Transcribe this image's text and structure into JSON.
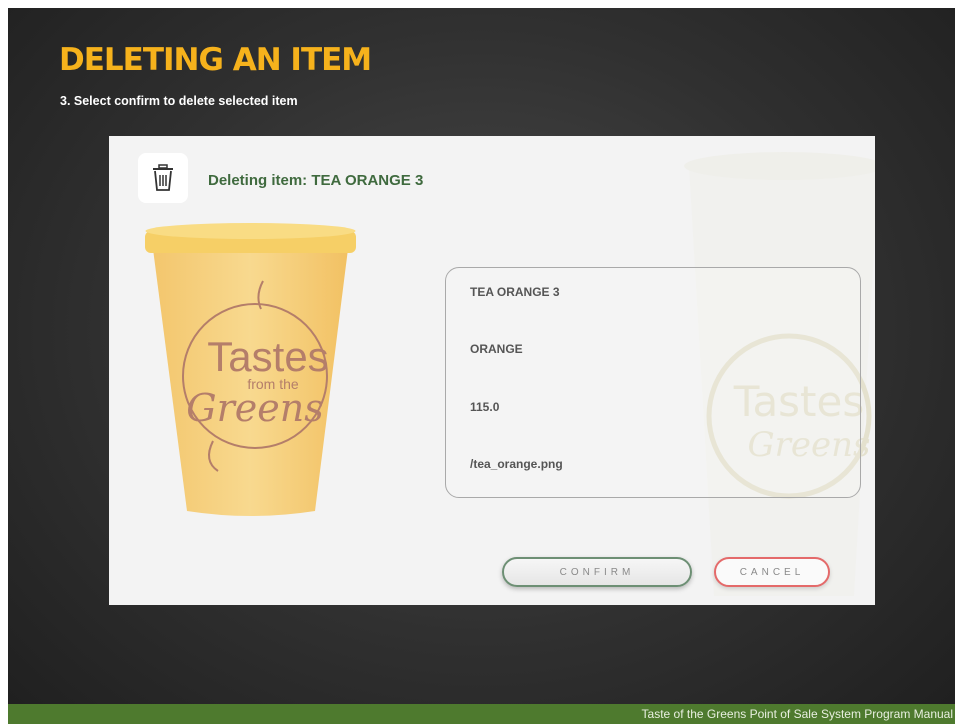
{
  "slide": {
    "title": "DELETING AN ITEM",
    "subtitle": "3.  Select confirm to delete selected item",
    "footer": "Taste of the Greens Point of Sale System Program Manual"
  },
  "dialog": {
    "heading": "Deleting item: TEA ORANGE 3",
    "cup_logo": [
      "Tastes",
      "from the",
      "Greens"
    ],
    "fields": [
      {
        "value": "TEA ORANGE 3"
      },
      {
        "value": "ORANGE"
      },
      {
        "value": "115.0"
      },
      {
        "value": "/tea_orange.png"
      }
    ],
    "confirm_label": "CONFIRM",
    "cancel_label": "CANCEL"
  },
  "colors": {
    "title": "#f6b21c",
    "heading": "#3f6a3e",
    "footer_bar": "#4e7a2e",
    "confirm_border": "#6d8f74",
    "cancel_border": "#e46a6a"
  },
  "icons": [
    "trash-icon",
    "cup-image"
  ]
}
